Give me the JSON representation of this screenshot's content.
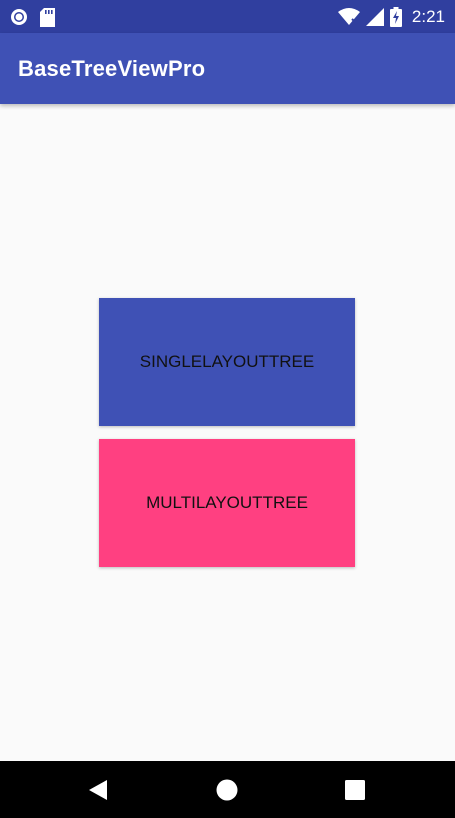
{
  "status_bar": {
    "time": "2:21",
    "icons": [
      "circle-notification-icon",
      "sd-card-icon",
      "wifi-icon",
      "signal-icon",
      "battery-charging-icon"
    ]
  },
  "app_bar": {
    "title": "BaseTreeViewPro"
  },
  "buttons": {
    "single_layout_tree": {
      "label": "SINGLELAYOUTTREE",
      "color": "#3f51b5"
    },
    "multi_layout_tree": {
      "label": "MULTILAYOUTTREE",
      "color": "#ff4081"
    }
  },
  "nav_bar": {
    "icons": [
      "back-icon",
      "home-icon",
      "recents-icon"
    ]
  },
  "colors": {
    "primary": "#3f51b5",
    "primary_dark": "#303f9f",
    "accent": "#ff4081",
    "background": "#fafafa"
  }
}
